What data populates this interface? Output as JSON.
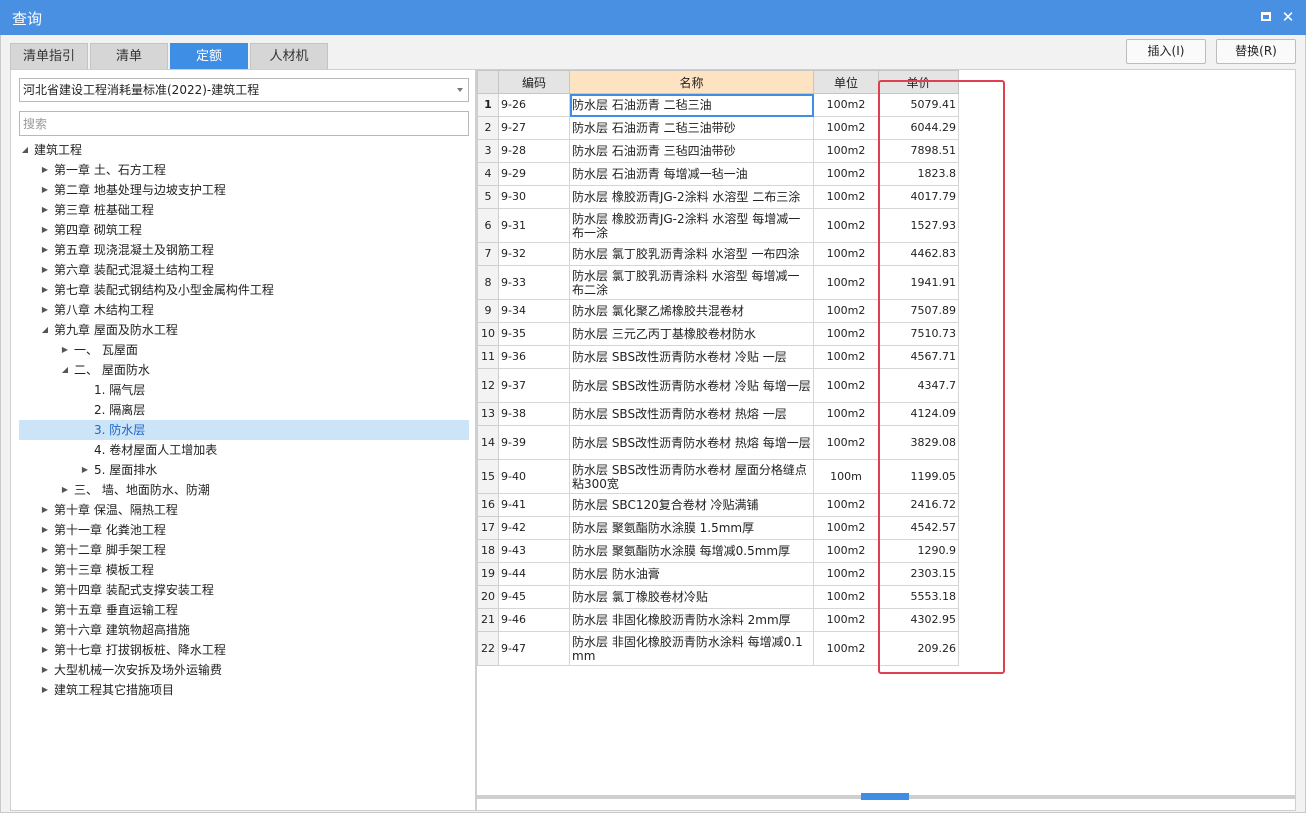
{
  "window": {
    "title": "查询"
  },
  "tabs": [
    {
      "label": "清单指引"
    },
    {
      "label": "清单"
    },
    {
      "label": "定额"
    },
    {
      "label": "人材机"
    }
  ],
  "buttons": {
    "insert": "插入(I)",
    "replace": "替换(R)"
  },
  "standard_select": {
    "value": "河北省建设工程消耗量标准(2022)-建筑工程"
  },
  "search": {
    "placeholder": "搜索"
  },
  "tree": [
    {
      "label": "建筑工程",
      "level": 0,
      "toggle": "expanded"
    },
    {
      "label": "第一章 土、石方工程",
      "level": 1,
      "toggle": "collapsed"
    },
    {
      "label": "第二章 地基处理与边坡支护工程",
      "level": 1,
      "toggle": "collapsed"
    },
    {
      "label": "第三章 桩基础工程",
      "level": 1,
      "toggle": "collapsed"
    },
    {
      "label": "第四章 砌筑工程",
      "level": 1,
      "toggle": "collapsed"
    },
    {
      "label": "第五章 现浇混凝土及钢筋工程",
      "level": 1,
      "toggle": "collapsed"
    },
    {
      "label": "第六章 装配式混凝土结构工程",
      "level": 1,
      "toggle": "collapsed"
    },
    {
      "label": "第七章 装配式钢结构及小型金属构件工程",
      "level": 1,
      "toggle": "collapsed"
    },
    {
      "label": "第八章 木结构工程",
      "level": 1,
      "toggle": "collapsed"
    },
    {
      "label": "第九章 屋面及防水工程",
      "level": 1,
      "toggle": "expanded"
    },
    {
      "label": "一、 瓦屋面",
      "level": 2,
      "toggle": "collapsed"
    },
    {
      "label": "二、 屋面防水",
      "level": 2,
      "toggle": "expanded"
    },
    {
      "label": "1. 隔气层",
      "level": 3,
      "toggle": "none"
    },
    {
      "label": "2. 隔离层",
      "level": 3,
      "toggle": "none"
    },
    {
      "label": "3. 防水层",
      "level": 3,
      "toggle": "none",
      "selected": true
    },
    {
      "label": "4. 卷材屋面人工增加表",
      "level": 3,
      "toggle": "none"
    },
    {
      "label": "5. 屋面排水",
      "level": 3,
      "toggle": "collapsed"
    },
    {
      "label": "三、 墙、地面防水、防潮",
      "level": 2,
      "toggle": "collapsed"
    },
    {
      "label": "第十章 保温、隔热工程",
      "level": 1,
      "toggle": "collapsed"
    },
    {
      "label": "第十一章 化粪池工程",
      "level": 1,
      "toggle": "collapsed"
    },
    {
      "label": "第十二章 脚手架工程",
      "level": 1,
      "toggle": "collapsed"
    },
    {
      "label": "第十三章 模板工程",
      "level": 1,
      "toggle": "collapsed"
    },
    {
      "label": "第十四章 装配式支撑安装工程",
      "level": 1,
      "toggle": "collapsed"
    },
    {
      "label": "第十五章 垂直运输工程",
      "level": 1,
      "toggle": "collapsed"
    },
    {
      "label": "第十六章 建筑物超高措施",
      "level": 1,
      "toggle": "collapsed"
    },
    {
      "label": "第十七章 打拔钢板桩、降水工程",
      "level": 1,
      "toggle": "collapsed"
    },
    {
      "label": "大型机械一次安拆及场外运输费",
      "level": 1,
      "toggle": "collapsed"
    },
    {
      "label": "建筑工程其它措施项目",
      "level": 1,
      "toggle": "collapsed"
    }
  ],
  "table": {
    "columns": [
      "",
      "编码",
      "名称",
      "单位",
      "单价"
    ],
    "rows": [
      {
        "no": "1",
        "code": "9-26",
        "name": "防水层 石油沥青 二毡三油",
        "unit": "100m2",
        "price": "5079.41"
      },
      {
        "no": "2",
        "code": "9-27",
        "name": "防水层 石油沥青 二毡三油带砂",
        "unit": "100m2",
        "price": "6044.29"
      },
      {
        "no": "3",
        "code": "9-28",
        "name": "防水层 石油沥青 三毡四油带砂",
        "unit": "100m2",
        "price": "7898.51"
      },
      {
        "no": "4",
        "code": "9-29",
        "name": "防水层 石油沥青 每增减一毡一油",
        "unit": "100m2",
        "price": "1823.8"
      },
      {
        "no": "5",
        "code": "9-30",
        "name": "防水层 橡胶沥青JG-2涂料 水溶型 二布三涂",
        "unit": "100m2",
        "price": "4017.79"
      },
      {
        "no": "6",
        "code": "9-31",
        "name": "防水层 橡胶沥青JG-2涂料 水溶型 每增减一布一涂",
        "unit": "100m2",
        "price": "1527.93"
      },
      {
        "no": "7",
        "code": "9-32",
        "name": "防水层 氯丁胶乳沥青涂料 水溶型 一布四涂",
        "unit": "100m2",
        "price": "4462.83"
      },
      {
        "no": "8",
        "code": "9-33",
        "name": "防水层 氯丁胶乳沥青涂料 水溶型 每增减一布二涂",
        "unit": "100m2",
        "price": "1941.91"
      },
      {
        "no": "9",
        "code": "9-34",
        "name": "防水层 氯化聚乙烯橡胶共混卷材",
        "unit": "100m2",
        "price": "7507.89"
      },
      {
        "no": "10",
        "code": "9-35",
        "name": "防水层 三元乙丙丁基橡胶卷材防水",
        "unit": "100m2",
        "price": "7510.73"
      },
      {
        "no": "11",
        "code": "9-36",
        "name": "防水层 SBS改性沥青防水卷材 冷贴 一层",
        "unit": "100m2",
        "price": "4567.71"
      },
      {
        "no": "12",
        "code": "9-37",
        "name": "防水层 SBS改性沥青防水卷材 冷贴 每增一层",
        "unit": "100m2",
        "price": "4347.7"
      },
      {
        "no": "13",
        "code": "9-38",
        "name": "防水层 SBS改性沥青防水卷材 热熔 一层",
        "unit": "100m2",
        "price": "4124.09"
      },
      {
        "no": "14",
        "code": "9-39",
        "name": "防水层 SBS改性沥青防水卷材 热熔 每增一层",
        "unit": "100m2",
        "price": "3829.08"
      },
      {
        "no": "15",
        "code": "9-40",
        "name": "防水层 SBS改性沥青防水卷材 屋面分格缝点粘300宽",
        "unit": "100m",
        "price": "1199.05"
      },
      {
        "no": "16",
        "code": "9-41",
        "name": "防水层 SBC120复合卷材 冷贴满铺",
        "unit": "100m2",
        "price": "2416.72"
      },
      {
        "no": "17",
        "code": "9-42",
        "name": "防水层 聚氨酯防水涂膜 1.5mm厚",
        "unit": "100m2",
        "price": "4542.57"
      },
      {
        "no": "18",
        "code": "9-43",
        "name": "防水层 聚氨酯防水涂膜 每增减0.5mm厚",
        "unit": "100m2",
        "price": "1290.9"
      },
      {
        "no": "19",
        "code": "9-44",
        "name": "防水层 防水油膏",
        "unit": "100m2",
        "price": "2303.15"
      },
      {
        "no": "20",
        "code": "9-45",
        "name": "防水层 氯丁橡胶卷材冷贴",
        "unit": "100m2",
        "price": "5553.18"
      },
      {
        "no": "21",
        "code": "9-46",
        "name": "防水层 非固化橡胶沥青防水涂料 2mm厚",
        "unit": "100m2",
        "price": "4302.95"
      },
      {
        "no": "22",
        "code": "9-47",
        "name": "防水层 非固化橡胶沥青防水涂料 每增减0.1mm",
        "unit": "100m2",
        "price": "209.26"
      }
    ]
  },
  "colors": {
    "accent": "#3d8ee4",
    "titlebar": "#4a90e2",
    "highlight_box": "#e0404e",
    "name_header": "#fde3c1",
    "tree_selected": "#cce4f7"
  },
  "icons": {
    "maximize": "maximize-icon",
    "close": "close-icon",
    "expanded": "triangle-down-icon",
    "collapsed": "triangle-right-icon"
  }
}
